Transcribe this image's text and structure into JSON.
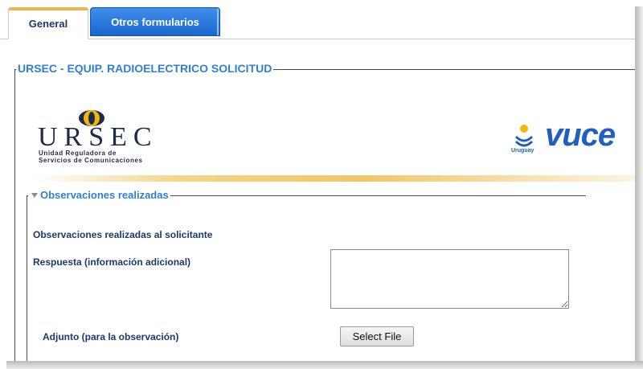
{
  "tabs": [
    {
      "label": "General",
      "active": true
    },
    {
      "label": "Otros formularios",
      "active": false
    }
  ],
  "form": {
    "title": "URSEC - EQUIP. RADIOELECTRICO SOLICITUD"
  },
  "header": {
    "ursec_logo": {
      "word": "URSEC",
      "line1": "Unidad Reguladora de",
      "line2": "Servicios de Comunicaciones"
    },
    "vuce_logo": {
      "word": "vuce",
      "country": "Uruguay"
    }
  },
  "section": {
    "legend": "Observaciones realizadas",
    "fields": {
      "observaciones_label": "Observaciones realizadas al solicitante",
      "respuesta_label": "Respuesta (información adicional)",
      "respuesta_value": "",
      "adjunto_label": "Adjunto (para la observación)",
      "select_file_label": "Select File"
    }
  },
  "colors": {
    "accent_blue": "#2f7fd4",
    "label_navy": "#1c3a6b",
    "tab_active_top": "#f0b44c",
    "tab_inactive": "#1a66d0",
    "vuce_blue": "#1f5fbf",
    "ursec_gold": "#f1b70f"
  },
  "icons": {
    "collapse": "triangle-down-icon",
    "ursec_emblem": "ursec-emblem-icon",
    "vuce_emblem": "sun-emblem-icon"
  }
}
